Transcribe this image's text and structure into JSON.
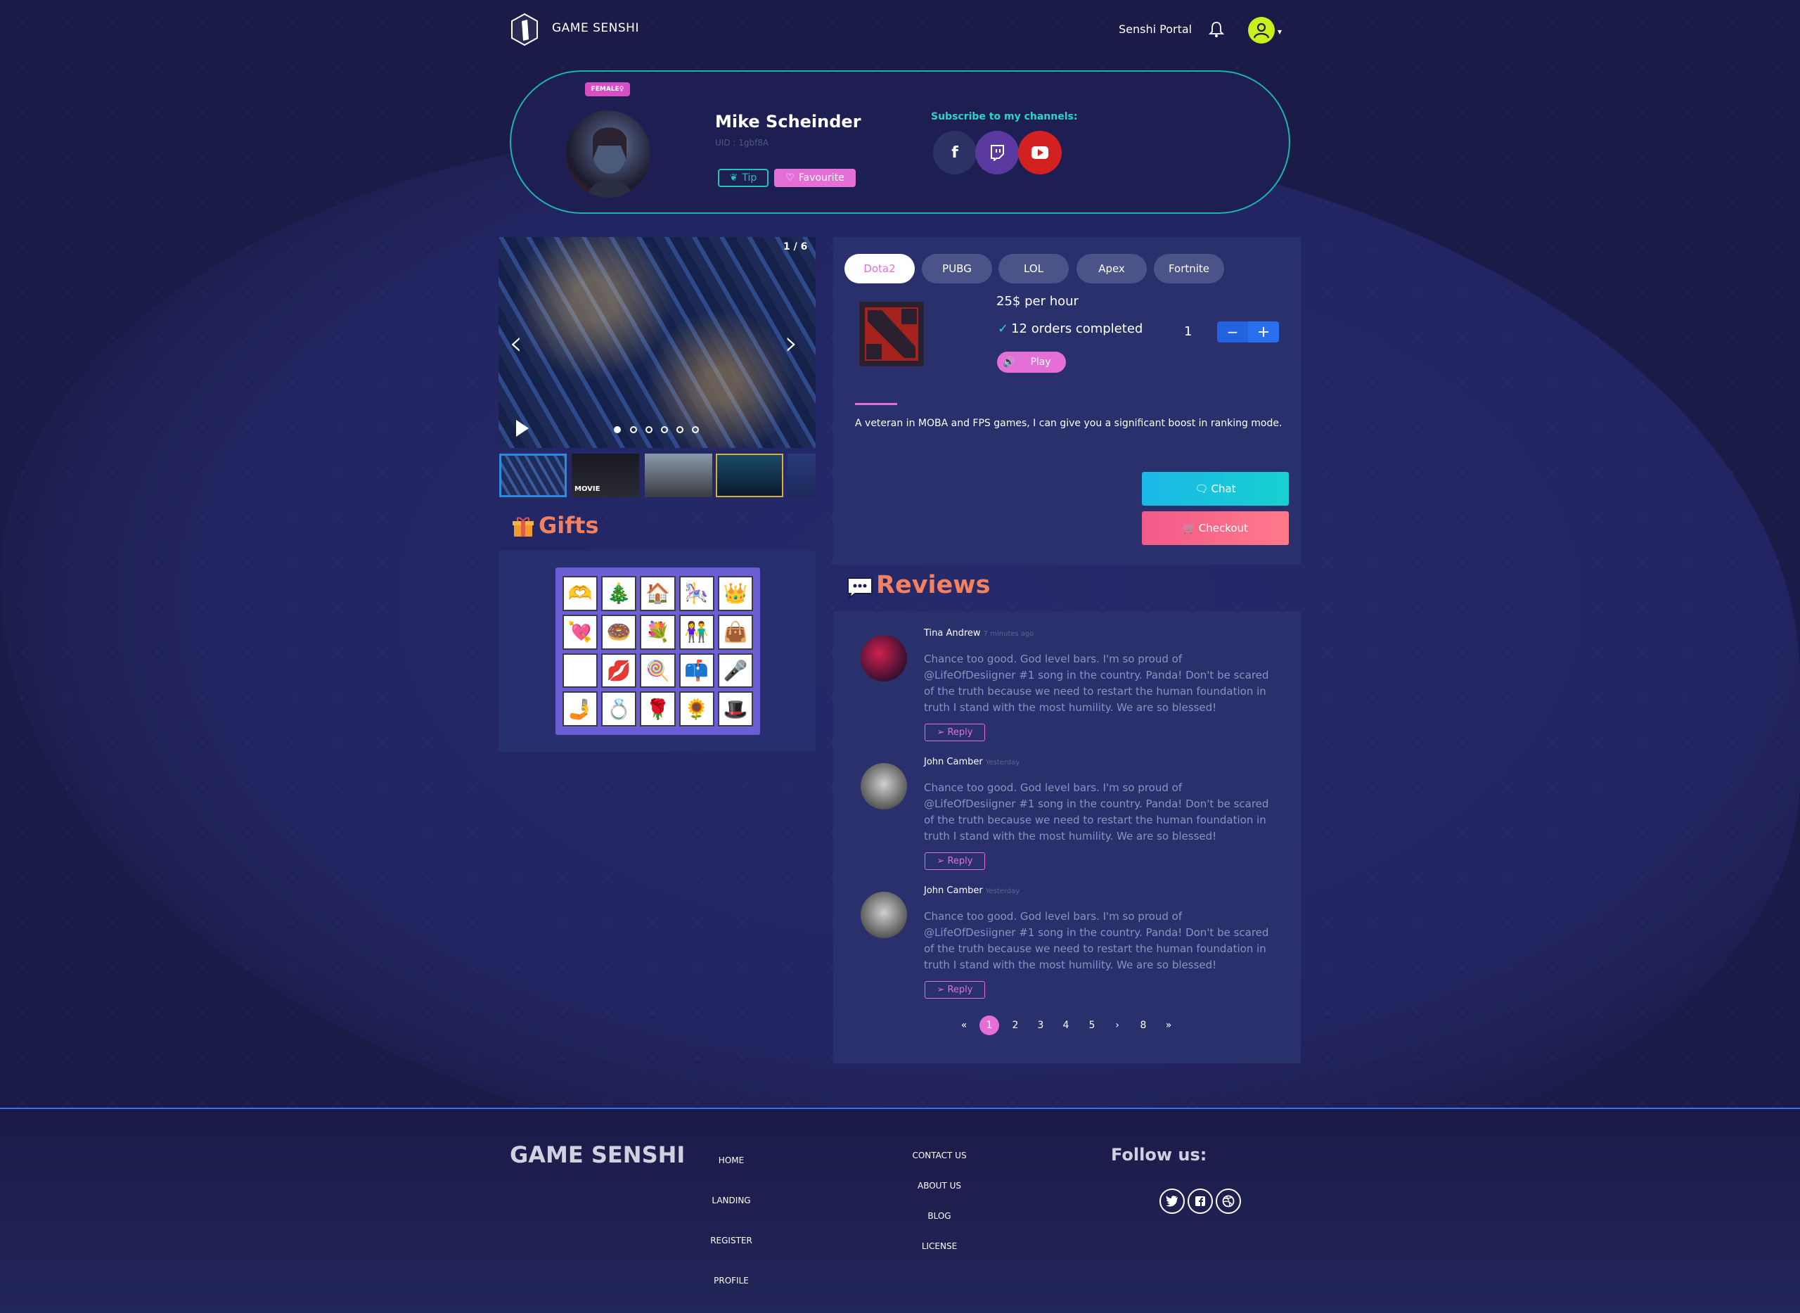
{
  "header": {
    "brand": "GAME SENSHI",
    "portal_link": "Senshi Portal"
  },
  "profile": {
    "gender_badge": "FEMALE♀",
    "name": "Mike Scheinder",
    "uid": "UID : 1gbf8A",
    "tip_label": "Tip",
    "favourite_label": "Favourite",
    "subscribe_label": "Subscribe to my channels:",
    "channels": [
      "facebook-icon",
      "twitch-icon",
      "youtube-icon"
    ]
  },
  "gallery": {
    "counter": "1 / 6",
    "slides": 6,
    "active_slide": 1,
    "thumb_movie_label": "MOVIE"
  },
  "gifts": {
    "title": "Gifts",
    "items": [
      "🫶",
      "🎄",
      "🏠",
      "🎠",
      "👑",
      "💘",
      "🍩",
      "💐",
      "👫",
      "👜",
      "🐱",
      "💋",
      "🍭",
      "📫",
      "🎤",
      "🤳",
      "💍",
      "🌹",
      "🌻",
      "🎩"
    ]
  },
  "game": {
    "tabs": [
      "Dota2",
      "PUBG",
      "LOL",
      "Apex",
      "Fortnite"
    ],
    "active_tab": "Dota2",
    "price": "25$ per hour",
    "orders": "12 orders completed",
    "quantity": "1",
    "play_label": "Play",
    "description": "A veteran in MOBA and FPS games, I can give you a significant boost in ranking mode.",
    "chat_label": "Chat",
    "checkout_label": "Checkout"
  },
  "reviews": {
    "title": "Reviews",
    "items": [
      {
        "name": "Tina Andrew",
        "time": "7 minutes ago",
        "text": "Chance too good. God level bars. I'm so proud of @LifeOfDesiigner #1 song in the country. Panda! Don't be scared of the truth because we need to restart the human foundation in truth I stand with the most humility. We are so blessed!",
        "reply": "Reply"
      },
      {
        "name": "John Camber",
        "time": "Yesterday",
        "text": "Chance too good. God level bars. I'm so proud of @LifeOfDesiigner #1 song in the country. Panda! Don't be scared of the truth because we need to restart the human foundation in truth I stand with the most humility. We are so blessed!",
        "reply": "Reply"
      },
      {
        "name": "John Camber",
        "time": "Yesterday",
        "text": "Chance too good. God level bars. I'm so proud of @LifeOfDesiigner #1 song in the country. Panda! Don't be scared of the truth because we need to restart the human foundation in truth I stand with the most humility. We are so blessed!",
        "reply": "Reply"
      }
    ],
    "pagination": [
      "«",
      "1",
      "2",
      "3",
      "4",
      "5",
      "›",
      "8",
      "»"
    ],
    "active_page": "1"
  },
  "footer": {
    "brand": "GAME SENSHI",
    "col1": [
      "HOME",
      "LANDING",
      "REGISTER",
      "PROFILE"
    ],
    "col2": [
      "CONTACT US",
      "ABOUT US",
      "BLOG",
      "LICENSE"
    ],
    "follow_label": "Follow us:",
    "social": [
      "twitter-icon",
      "facebook-icon",
      "dribbble-icon"
    ]
  },
  "colors": {
    "background": "#1b1b48",
    "accent_pink": "#e46fd6",
    "accent_teal": "#1cb3b0",
    "accent_orange": "#f3815f"
  }
}
